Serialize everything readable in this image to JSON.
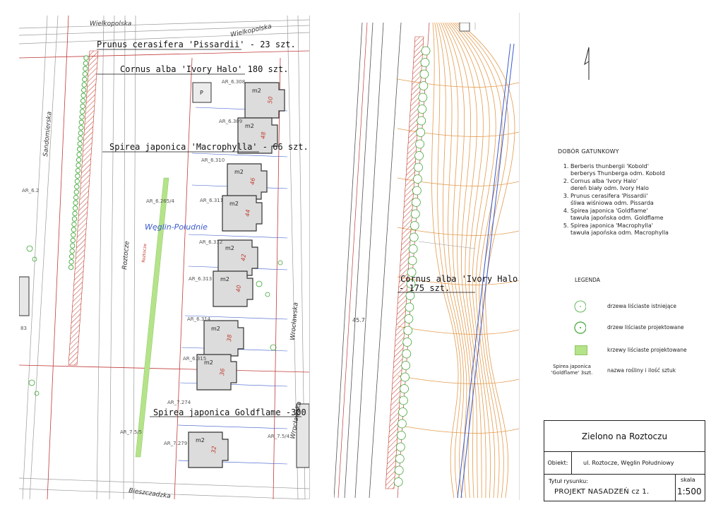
{
  "left_map": {
    "labels": {
      "prunus": "Prunus cerasifera 'Pissardii' - 23 szt.",
      "cornus": "Cornus alba 'Ivory Halo' 180 szt.",
      "spirea_macro": "Spirea japonica 'Macrophylla' - 66 szt.",
      "spirea_gold": "Spirea japonica Goldflame -300 szt."
    },
    "streets": {
      "wielkopolska_1": "Wielkopolska",
      "wielkopolska_2": "Wielkopolska",
      "sandomierska": "Sandomierska",
      "roztocze": "Roztocze",
      "roztocze_2": "Roztocze",
      "wroclawska": "Wrocławska",
      "wroclawska_2": "Wrocławska",
      "bieszczadzka": "Bieszczadzka"
    },
    "district": "Węglin-Południe",
    "parcels": [
      "AR_6.308",
      "AR_6.309",
      "AR_6.310",
      "AR_6.311",
      "AR_6.312",
      "AR_6.313",
      "AR_6.314",
      "AR_6.315",
      "AR_6.265/4",
      "AR_6.2",
      "AR_7.274",
      "AR_7.279",
      "AR_7.5/5",
      "AR_7.5/4"
    ],
    "buildings": [
      {
        "area": "m2",
        "number": "50"
      },
      {
        "area": "m2",
        "number": "48"
      },
      {
        "area": "m2",
        "number": "46"
      },
      {
        "area": "m2",
        "number": "44"
      },
      {
        "area": "m2",
        "number": "42"
      },
      {
        "area": "m2",
        "number": "40"
      },
      {
        "area": "m2",
        "number": "38"
      },
      {
        "area": "m2",
        "number": "36"
      },
      {
        "area": "m2",
        "number": "32"
      }
    ],
    "misc": {
      "parking": "P",
      "num_83": "83"
    }
  },
  "right_map": {
    "label_line1": "Cornus alba 'Ivory Halo'",
    "label_line2": "- 175 szt.",
    "note_457": "45.7"
  },
  "north_arrow": "north-arrow-icon",
  "species": {
    "header": "DOBÓR GATUNKOWY",
    "items": [
      {
        "latin": "Berberis thunbergii 'Kobold'",
        "polish": "berberys Thunberga  odm. Kobold"
      },
      {
        "latin": "Cornus alba 'Ivory Halo'",
        "polish": "dereń biały odm. Ivory Halo"
      },
      {
        "latin": "Prunus cerasifera 'Pissardii'",
        "polish": "śliwa wiśniowa odm. Pissarda"
      },
      {
        "latin": "Spirea japonica 'Goldflame'",
        "polish": "tawuła japońska odm. Goldflame"
      },
      {
        "latin": "Spirea japonica 'Macrophylla'",
        "polish": "tawuła japońska odm. Macrophylla"
      }
    ]
  },
  "legend": {
    "header": "LEGENDA",
    "items": [
      {
        "label": "drzewa liściaste istniejące",
        "symbol": "existing-tree-icon"
      },
      {
        "label": "drzew liściaste projektowane",
        "symbol": "planned-tree-icon"
      },
      {
        "label": "krzewy liściaste projektowane",
        "symbol": "shrub-swatch-icon",
        "color": "#b5e38a"
      }
    ],
    "sample_line1": "Spirea japonica",
    "sample_line2": "'Goldflame' 3szt.",
    "sample_desc": "nazwa rośliny i ilość sztuk"
  },
  "title_block": {
    "project": "Zielono na Roztoczu",
    "object_label": "Obiekt:",
    "object_value": "ul. Roztocze, Węglin Południowy",
    "drawing_label": "Tytuł rysunku:",
    "drawing_value": "PROJEKT NASADZEŃ  cz 1.",
    "scale_label": "skala",
    "scale_value": "1:500"
  },
  "colors": {
    "hatch": "#c0392b",
    "shrub_green": "#b5e38a",
    "tree_green": "#3fa535",
    "contour": "#e39a4c",
    "blue_line": "#3b5bcc",
    "building_fill": "#d9d9d9"
  }
}
